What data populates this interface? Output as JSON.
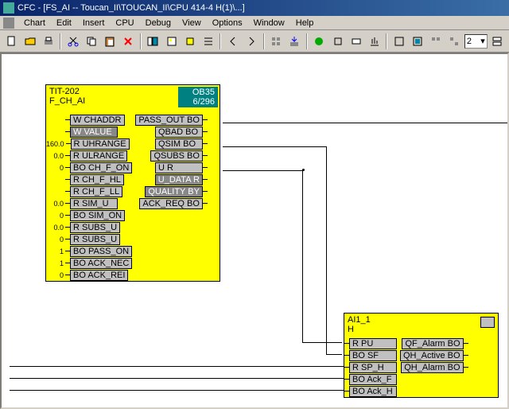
{
  "title": "CFC - [FS_AI -- Toucan_II\\TOUCAN_II\\CPU 414-4 H(1)\\...]",
  "menu": {
    "chart": "Chart",
    "edit": "Edit",
    "insert": "Insert",
    "cpu": "CPU",
    "debug": "Debug",
    "view": "View",
    "options": "Options",
    "window": "Window",
    "help": "Help"
  },
  "toolbar": {
    "combo_val": "2"
  },
  "block1": {
    "name": "TIT-202",
    "type": "F_CH_AI",
    "ob": "OB35",
    "pos": "6/296",
    "inputs": [
      {
        "val": "",
        "type": "W",
        "label": "CHADDR"
      },
      {
        "val": "",
        "type": "W",
        "label": "VALUE",
        "sel": true
      },
      {
        "val": "160.0",
        "type": "R",
        "label": "UHRANGE"
      },
      {
        "val": "0.0",
        "type": "R",
        "label": "ULRANGE"
      },
      {
        "val": "0",
        "type": "BO",
        "label": "CH_F_ON"
      },
      {
        "val": "",
        "type": "R",
        "label": "CH_F_HL"
      },
      {
        "val": "",
        "type": "R",
        "label": "CH_F_LL"
      },
      {
        "val": "0.0",
        "type": "R",
        "label": "SIM_U"
      },
      {
        "val": "0",
        "type": "BO",
        "label": "SIM_ON"
      },
      {
        "val": "0.0",
        "type": "R",
        "label": "SUBS_U"
      },
      {
        "val": "0",
        "type": "R",
        "label": "SUBS_U"
      },
      {
        "val": "1",
        "type": "BO",
        "label": "PASS_ON"
      },
      {
        "val": "1",
        "type": "BO",
        "label": "ACK_NEC"
      },
      {
        "val": "0",
        "type": "BO",
        "label": "ACK_REI"
      }
    ],
    "outputs": [
      {
        "label": "PASS_OUT",
        "type": "BO"
      },
      {
        "label": "QBAD",
        "type": "BO"
      },
      {
        "label": "QSIM",
        "type": "BO"
      },
      {
        "label": "QSUBS",
        "type": "BO"
      },
      {
        "label": "U",
        "type": "R"
      },
      {
        "label": "U_DATA",
        "type": "R",
        "sel": true
      },
      {
        "label": "QUALITY",
        "type": "BY",
        "sel": true
      },
      {
        "label": "ACK_REQ",
        "type": "BO"
      }
    ]
  },
  "block2": {
    "name": "AI1_1",
    "type": "H",
    "inputs": [
      {
        "type": "R",
        "label": "PU"
      },
      {
        "type": "BO",
        "label": "SF"
      },
      {
        "type": "R",
        "label": "SP_H"
      },
      {
        "type": "BO",
        "label": "Ack_F"
      },
      {
        "type": "BO",
        "label": "Ack_H"
      }
    ],
    "outputs": [
      {
        "label": "QF_Alarm",
        "type": "BO"
      },
      {
        "label": "QH_Active",
        "type": "BO"
      },
      {
        "label": "QH_Alarm",
        "type": "BO"
      }
    ]
  }
}
